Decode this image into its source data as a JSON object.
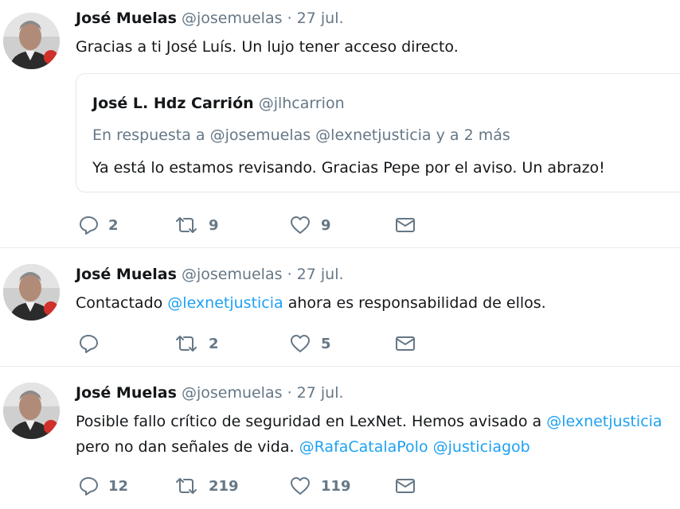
{
  "tweets": [
    {
      "author": "José Muelas",
      "handle": "@josemuelas",
      "separator": "·",
      "date": "27 jul.",
      "text": "Gracias a ti José Luís. Un lujo tener acceso directo.",
      "quote": {
        "author": "José L. Hdz Carrión",
        "handle": "@jlhcarrion",
        "reply_prefix": "En respuesta a",
        "reply_targets": "@josemuelas @lexnetjusticia",
        "reply_suffix": "y a 2 más",
        "text": "Ya está lo estamos revisando. Gracias Pepe por el aviso. Un abrazo!"
      },
      "replies": "2",
      "retweets": "9",
      "likes": "9"
    },
    {
      "author": "José Muelas",
      "handle": "@josemuelas",
      "separator": "·",
      "date": "27 jul.",
      "text_before": "Contactado",
      "mention": "@lexnetjusticia",
      "text_after": "ahora es responsabilidad de ellos.",
      "replies": "",
      "retweets": "2",
      "likes": "5"
    },
    {
      "author": "José Muelas",
      "handle": "@josemuelas",
      "separator": "·",
      "date": "27 jul.",
      "line1_text": "Posible fallo crítico de seguridad en LexNet. Hemos avisado a",
      "line1_mention": "@lexnetjusticia",
      "line2_text": "pero no dan señales de vida.",
      "line2_mention1": "@RafaCatalaPolo",
      "line2_mention2": "@justiciagob",
      "replies": "12",
      "retweets": "219",
      "likes": "119"
    }
  ],
  "icons": {
    "reply": "reply-icon",
    "retweet": "retweet-icon",
    "like": "heart-icon",
    "message": "envelope-icon"
  },
  "colors": {
    "link": "#1da1f2",
    "muted": "#657786",
    "text": "#14171a",
    "divider": "#e6ecf0"
  }
}
